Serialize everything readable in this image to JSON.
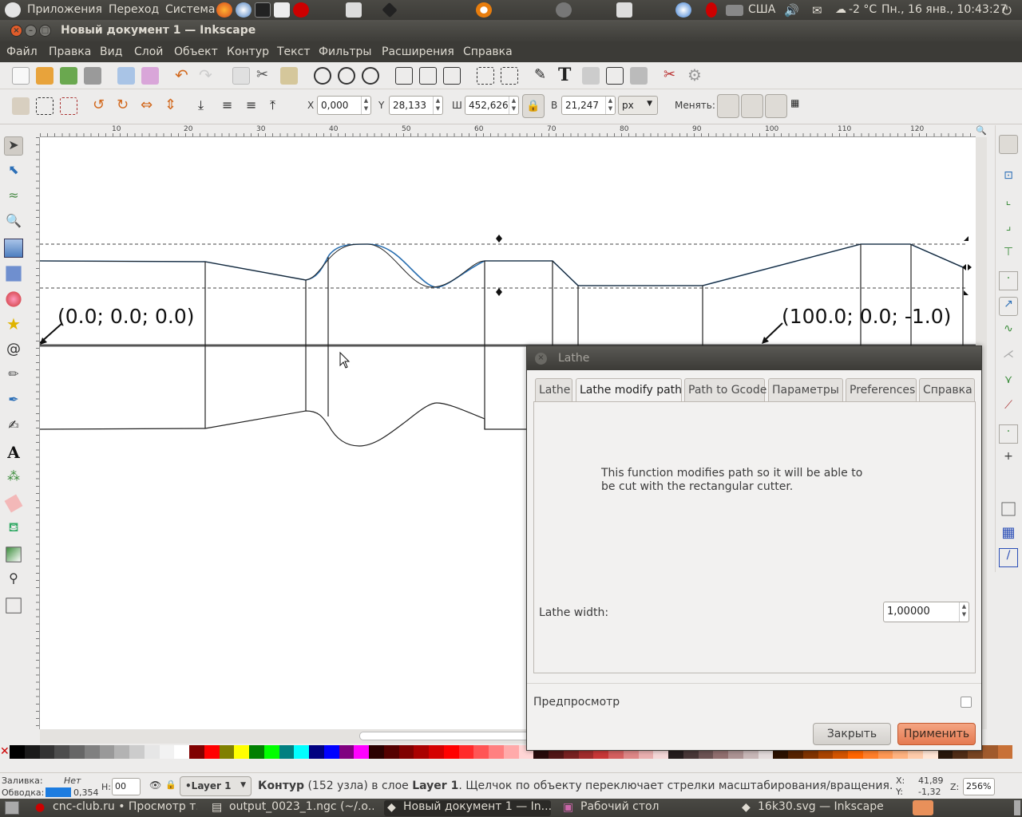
{
  "top_panel": {
    "menu_apps": "Приложения",
    "menu_places": "Переход",
    "menu_system": "Система",
    "keyboard_layout": "США",
    "weather": "-2 °C",
    "clock": "Пн., 16 янв., 10:43:27"
  },
  "window": {
    "title": "Новый документ 1 — Inkscape",
    "menu": [
      "Файл",
      "Правка",
      "Вид",
      "Слой",
      "Объект",
      "Контур",
      "Текст",
      "Фильтры",
      "Расширения",
      "Справка"
    ]
  },
  "controls": {
    "x_label": "X",
    "x_value": "0,000",
    "y_label": "Y",
    "y_value": "28,133",
    "w_label": "Ш",
    "w_value": "452,626",
    "h_label": "В",
    "h_value": "21,247",
    "unit": "px",
    "change_label": "Менять:"
  },
  "ruler_top": [
    "10",
    "20",
    "30",
    "40",
    "50",
    "60",
    "70",
    "80",
    "90",
    "100",
    "110",
    "120"
  ],
  "canvas": {
    "label_left": "(0.0; 0.0; 0.0)",
    "label_right": "(100.0; 0.0; -1.0)"
  },
  "dialog": {
    "title": "Lathe",
    "tabs": [
      "Lathe",
      "Lathe modify path",
      "Path to Gcode",
      "Параметры",
      "Preferences",
      "Справка"
    ],
    "active_tab": "Lathe modify path",
    "description": "This function modifies path so it will be able to\nbe cut with the rectangular cutter.",
    "width_label": "Lathe width:",
    "width_value": "1,00000",
    "preview_label": "Предпросмотр",
    "close_button": "Закрыть",
    "apply_button": "Применить"
  },
  "palette": [
    "#000000",
    "#1a1a1a",
    "#333333",
    "#4d4d4d",
    "#666666",
    "#808080",
    "#999999",
    "#b3b3b3",
    "#cccccc",
    "#e6e6e6",
    "#f2f2f2",
    "#ffffff",
    "#800000",
    "#ff0000",
    "#808000",
    "#ffff00",
    "#008000",
    "#00ff00",
    "#008080",
    "#00ffff",
    "#000080",
    "#0000ff",
    "#800080",
    "#ff00ff",
    "#2b0000",
    "#550000",
    "#800000",
    "#aa0000",
    "#d40000",
    "#ff0000",
    "#ff2a2a",
    "#ff5555",
    "#ff8080",
    "#ffaaaa",
    "#ffd5d5",
    "#280b0b",
    "#501616",
    "#782121",
    "#a02c2c",
    "#c83737",
    "#d35f5f",
    "#de8787",
    "#e9afaf",
    "#f4d7d7",
    "#241c1c",
    "#483737",
    "#6c5353",
    "#916f6f",
    "#ac9393",
    "#c8b7b7",
    "#e3dbdb",
    "#2b1100",
    "#552200",
    "#803300",
    "#aa4400",
    "#d45500",
    "#ff6600",
    "#ff7f2a",
    "#ff9955",
    "#ffb380",
    "#ffccaa",
    "#ffe6d5",
    "#28170b",
    "#502d16",
    "#784421",
    "#a05a2c",
    "#c87137"
  ],
  "status": {
    "fill_label": "Заливка:",
    "fill_value": "Нет",
    "stroke_label": "Обводка:",
    "stroke_width": "0,354",
    "opacity_label": "Н:",
    "opacity_value": "00",
    "layer": "•Layer 1",
    "message_bold": "Контур",
    "message_rest": " (152 узла) в слое ",
    "message_layer": "Layer 1",
    "message_tail": ". Щелчок по объекту переключает стрелки масштабирования/вращения.",
    "cursor_x_label": "X:",
    "cursor_x": "41,89",
    "cursor_y_label": "Y:",
    "cursor_y": "-1,32",
    "zoom_label": "Z:",
    "zoom": "256%"
  },
  "taskbar": {
    "items": [
      "cnc-club.ru • Просмотр т...",
      "output_0023_1.ngc (~/.o...",
      "Новый документ 1 — In...",
      "Рабочий стол",
      "16k30.svg — Inkscape"
    ]
  }
}
